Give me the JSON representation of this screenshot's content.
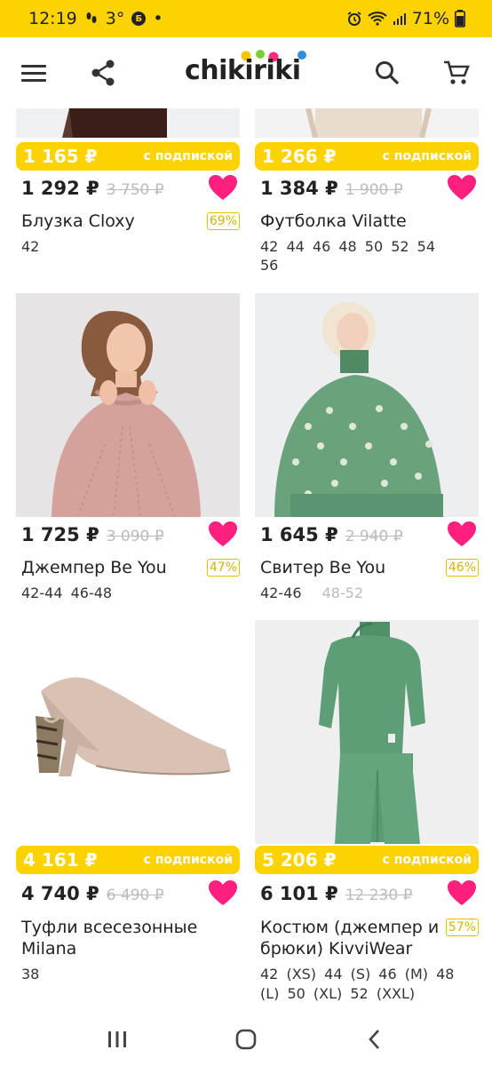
{
  "status_bar": {
    "time": "12:19",
    "temp": "3°",
    "badge": "Б",
    "dot": "•",
    "battery": "71%"
  },
  "header": {
    "logo": "chikiriki"
  },
  "products": [
    {
      "sub_price": "1 165 ₽",
      "sub_label": "с подпиской",
      "price": "1 292 ₽",
      "old_price": "3 750 ₽",
      "title": "Блузка Cloxy",
      "discount": "69%",
      "sizes": [
        "42"
      ]
    },
    {
      "sub_price": "1 266 ₽",
      "sub_label": "с подпиской",
      "price": "1 384 ₽",
      "old_price": "1 900 ₽",
      "title": "Футболка Vilatte",
      "discount": "",
      "sizes_line1": "42  44  46  48  50  52  54",
      "sizes_line2": "56"
    },
    {
      "price": "1 725 ₽",
      "old_price": "3 090 ₽",
      "title": "Джемпер Be You",
      "discount": "47%",
      "sizes_text": "42-44   46-48"
    },
    {
      "price": "1 645 ₽",
      "old_price": "2 940 ₽",
      "title": "Свитер Be You",
      "discount": "46%",
      "size_available": "42-46",
      "size_unavailable": "48-52"
    },
    {
      "sub_price": "4 161 ₽",
      "sub_label": "с подпиской",
      "price": "4 740 ₽",
      "old_price": "6 490 ₽",
      "title_line1": "Туфли всесезонные",
      "title_line2": "Milana",
      "discount": "",
      "sizes_text": "38"
    },
    {
      "sub_price": "5 206 ₽",
      "sub_label": "с подпиской",
      "price": "6 101 ₽",
      "old_price": "12 230 ₽",
      "title_line1": "Костюм (джемпер и",
      "title_line2": "брюки) KivviWear",
      "discount": "57%",
      "sizes_line1": "42 (XS)   44 (S)   46 (M)   48",
      "sizes_line2": "(L)   50 (XL)   52 (XXL)"
    }
  ],
  "colors": {
    "brand_yellow": "#fcd200",
    "heart_pink": "#ff1f7e"
  }
}
